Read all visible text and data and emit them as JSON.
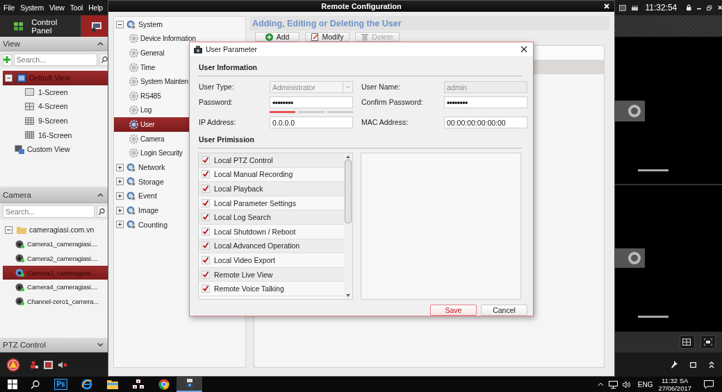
{
  "app": {
    "menu": [
      "File",
      "System",
      "View",
      "Tool",
      "Help"
    ],
    "clock": "11:32:54",
    "tabs": [
      {
        "label": "Control Panel",
        "kind": "text",
        "selected": false
      },
      {
        "kind": "icon",
        "selected": true
      }
    ],
    "view_panel": {
      "title": "View",
      "expanded": true,
      "search": {
        "placeholder": "Search..."
      },
      "tree": [
        {
          "label": "Default View",
          "kind": "view-group",
          "selected": true,
          "expanded": true,
          "children": [
            {
              "label": "1-Screen",
              "kind": "screen-1",
              "selected": false
            },
            {
              "label": "4-Screen",
              "kind": "screen-4",
              "selected": false
            },
            {
              "label": "9-Screen",
              "kind": "screen-9",
              "selected": false
            },
            {
              "label": "16-Screen",
              "kind": "screen-16",
              "selected": false
            }
          ]
        },
        {
          "label": "Custom View",
          "kind": "custom-view",
          "selected": false
        }
      ]
    },
    "camera_panel": {
      "title": "Camera",
      "expanded": true,
      "search": {
        "placeholder": "Search..."
      },
      "tree": [
        {
          "label": "cameragiasi.com.vn",
          "kind": "folder",
          "selected": false,
          "expanded": true,
          "children": [
            {
              "label": "Camera1_cameragiasi....",
              "kind": "camera",
              "selected": false
            },
            {
              "label": "Camera2_cameragiasi....",
              "kind": "camera",
              "selected": false
            },
            {
              "label": "Camera3_cameragiasi....",
              "kind": "camera",
              "selected": true
            },
            {
              "label": "Camera4_cameragiasi....",
              "kind": "camera",
              "selected": false
            },
            {
              "label": "Channel-zero1_camera...",
              "kind": "camera",
              "selected": false
            }
          ]
        }
      ]
    },
    "ptz_panel": {
      "title": "PTZ Control",
      "expanded": false
    }
  },
  "remote_config": {
    "title": "Remote Configuration",
    "tree": [
      {
        "label": "System",
        "selected": false,
        "expanded": true,
        "children": [
          {
            "label": "Device Information",
            "selected": false
          },
          {
            "label": "General",
            "selected": false
          },
          {
            "label": "Time",
            "selected": false
          },
          {
            "label": "System Mainten",
            "selected": false
          },
          {
            "label": "RS485",
            "selected": false
          },
          {
            "label": "Log",
            "selected": false
          },
          {
            "label": "User",
            "selected": true
          },
          {
            "label": "Camera",
            "selected": false
          },
          {
            "label": "Login Security",
            "selected": false
          }
        ]
      },
      {
        "label": "Network",
        "selected": false,
        "expanded": false
      },
      {
        "label": "Storage",
        "selected": false,
        "expanded": false
      },
      {
        "label": "Event",
        "selected": false,
        "expanded": false
      },
      {
        "label": "Image",
        "selected": false,
        "expanded": false
      },
      {
        "label": "Counting",
        "selected": false,
        "expanded": false
      }
    ],
    "heading": "Adding, Editing or Deleting the User",
    "buttons": [
      {
        "label": "Add",
        "kind": "add",
        "disabled": false
      },
      {
        "label": "Modify",
        "kind": "modify",
        "disabled": false
      },
      {
        "label": "Delete",
        "kind": "delete",
        "disabled": true
      }
    ],
    "user_table": {
      "rows": [
        {
          "selected": true
        }
      ]
    }
  },
  "dialog": {
    "title": "User Parameter",
    "info_heading": "User Information",
    "fields": [
      {
        "label": "User Type:",
        "kind": "select",
        "value": "Administrator",
        "disabled": true
      },
      {
        "label": "User Name:",
        "kind": "text",
        "value": "admin",
        "disabled": true
      },
      {
        "label": "Password:",
        "kind": "password",
        "value": "••••••••",
        "disabled": false,
        "level": 0.33
      },
      {
        "label": "Confirm Password:",
        "kind": "password",
        "value": "••••••••",
        "disabled": false
      },
      {
        "label": "IP Address:",
        "kind": "text",
        "value": "0.0.0.0",
        "disabled": false
      },
      {
        "label": "MAC Address:",
        "kind": "text",
        "value": "00:00:00:00:00:00",
        "disabled": false
      }
    ],
    "permission_heading": "User Primission",
    "permissions": [
      {
        "label": "Local PTZ Control",
        "checked": true
      },
      {
        "label": "Local Manual Recording",
        "checked": true
      },
      {
        "label": "Local Playback",
        "checked": true
      },
      {
        "label": "Local Parameter Settings",
        "checked": true
      },
      {
        "label": "Local Log Search",
        "checked": true
      },
      {
        "label": "Local Shutdown / Reboot",
        "checked": true
      },
      {
        "label": "Local Advanced Operation",
        "checked": true
      },
      {
        "label": "Local Video Export",
        "checked": true
      },
      {
        "label": "Remote Live View",
        "checked": true
      },
      {
        "label": "Remote Voice Talking",
        "checked": true
      }
    ],
    "buttons": [
      {
        "label": "Save",
        "kind": "primary"
      },
      {
        "label": "Cancel",
        "kind": "secondary"
      }
    ]
  },
  "taskbar": {
    "apps": [
      {
        "kind": "search",
        "selected": false
      },
      {
        "kind": "photoshop",
        "label": "Ps",
        "selected": false
      },
      {
        "kind": "browser",
        "selected": false
      },
      {
        "kind": "folder",
        "selected": false
      },
      {
        "kind": "network-app",
        "selected": false
      },
      {
        "kind": "chrome",
        "selected": false
      },
      {
        "kind": "camera-app",
        "selected": true
      }
    ],
    "language": "ENG",
    "time": "11:32 SA",
    "date": "27/06/2017"
  }
}
